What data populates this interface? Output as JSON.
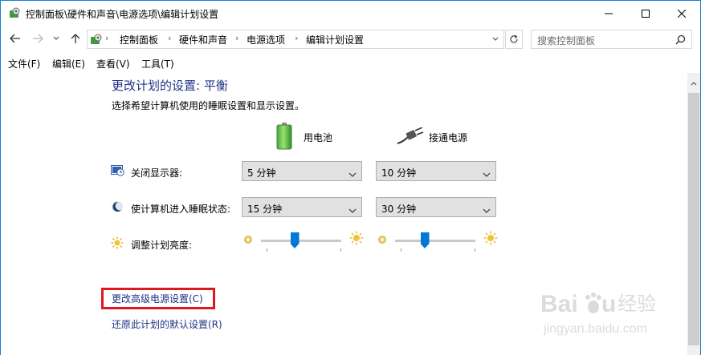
{
  "window": {
    "title": "控制面板\\硬件和声音\\电源选项\\编辑计划设置"
  },
  "address": {
    "crumbs": [
      "控制面板",
      "硬件和声音",
      "电源选项",
      "编辑计划设置"
    ],
    "search_placeholder": "搜索控制面板"
  },
  "menu": [
    "文件(F)",
    "编辑(E)",
    "查看(V)",
    "工具(T)"
  ],
  "page": {
    "heading": "更改计划的设置: 平衡",
    "subtext": "选择希望计算机使用的睡眠设置和显示设置。",
    "col_battery": "用电池",
    "col_plugged": "接通电源",
    "rows": [
      {
        "label": "关闭显示器:",
        "battery": "5 分钟",
        "plugged": "10 分钟"
      },
      {
        "label": "使计算机进入睡眠状态:",
        "battery": "15 分钟",
        "plugged": "30 分钟"
      }
    ],
    "brightness_label": "调整计划亮度:",
    "brightness": {
      "battery": 0.42,
      "plugged": 0.37
    },
    "link_advanced": "更改高级电源设置(C)",
    "link_restore": "还原此计划的默认设置(R)"
  },
  "watermark": {
    "brand": "Baidu经验",
    "url": "jingyan.baidu.com"
  },
  "colors": {
    "link": "#1e3287",
    "accent": "#0078d7",
    "highlight_box": "#e0181e"
  }
}
